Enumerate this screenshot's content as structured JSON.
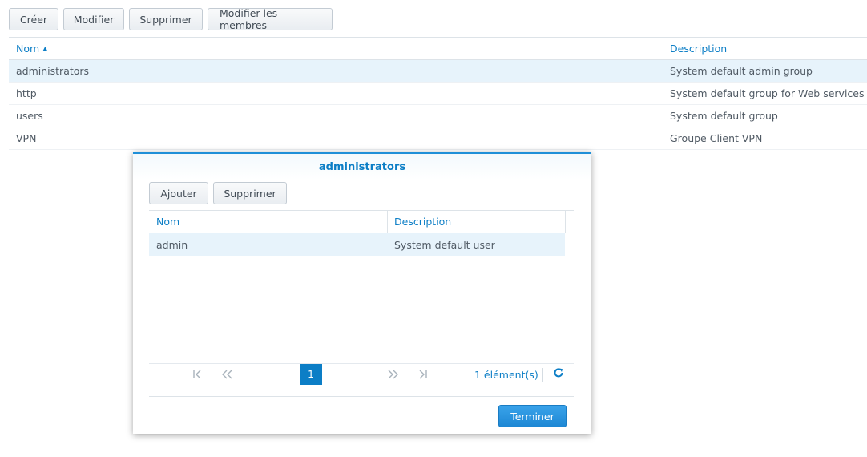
{
  "toolbar": {
    "create": "Créer",
    "modify": "Modifier",
    "delete": "Supprimer",
    "edit_members": "Modifier les membres"
  },
  "grid": {
    "columns": {
      "name": "Nom",
      "description": "Description"
    },
    "sort_indicator": "▲",
    "rows": [
      {
        "name": "administrators",
        "description": "System default admin group",
        "selected": true
      },
      {
        "name": "http",
        "description": "System default group for Web services"
      },
      {
        "name": "users",
        "description": "System default group"
      },
      {
        "name": "VPN",
        "description": "Groupe Client VPN"
      }
    ]
  },
  "modal": {
    "title": "administrators",
    "add": "Ajouter",
    "delete": "Supprimer",
    "columns": {
      "name": "Nom",
      "description": "Description"
    },
    "rows": [
      {
        "name": "admin",
        "description": "System default user"
      }
    ],
    "pager": {
      "first_icon": "first-page-icon",
      "prev_icon": "previous-page-icon",
      "next_icon": "next-page-icon",
      "last_icon": "last-page-icon",
      "current_page": "1",
      "count": "1 élément(s)",
      "refresh_icon": "refresh-icon"
    },
    "finish": "Terminer"
  },
  "colors": {
    "accent": "#0c7ec6",
    "selected_row": "#e7f3fb",
    "primary_button": "#1d87d4"
  }
}
